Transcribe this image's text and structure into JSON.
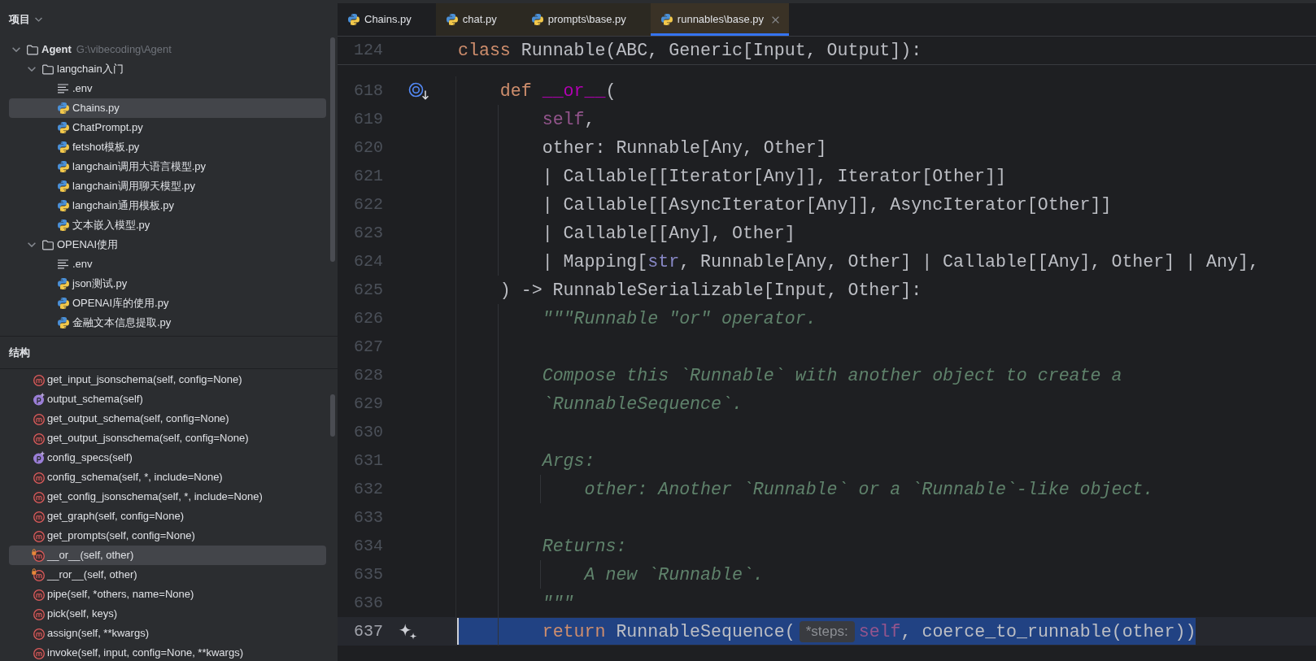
{
  "project": {
    "title": "项目",
    "tree": [
      {
        "kind": "folder",
        "label": "Agent",
        "path": "G:\\vibecoding\\Agent",
        "expanded": true,
        "selected": false,
        "children": [
          {
            "kind": "folder",
            "label": "langchain入门",
            "expanded": true,
            "selected": false,
            "children": [
              {
                "kind": "text",
                "label": ".env",
                "selected": false
              },
              {
                "kind": "python",
                "label": "Chains.py",
                "selected": true
              },
              {
                "kind": "python",
                "label": "ChatPrompt.py",
                "selected": false
              },
              {
                "kind": "python",
                "label": "fetshot模板.py",
                "selected": false
              },
              {
                "kind": "python",
                "label": "langchain调用大语言模型.py",
                "selected": false
              },
              {
                "kind": "python",
                "label": "langchain调用聊天模型.py",
                "selected": false
              },
              {
                "kind": "python",
                "label": "langchain通用模板.py",
                "selected": false
              },
              {
                "kind": "python",
                "label": "文本嵌入模型.py",
                "selected": false
              }
            ]
          },
          {
            "kind": "folder",
            "label": "OPENAI使用",
            "expanded": true,
            "selected": false,
            "children": [
              {
                "kind": "text",
                "label": ".env",
                "selected": false
              },
              {
                "kind": "python",
                "label": "json测试.py",
                "selected": false
              },
              {
                "kind": "python",
                "label": "OPENAI库的使用.py",
                "selected": false
              },
              {
                "kind": "python",
                "label": "金融文本信息提取.py",
                "selected": false
              }
            ]
          }
        ]
      }
    ]
  },
  "structure": {
    "title": "结构",
    "items": [
      {
        "kind": "method",
        "label": "get_input_jsonschema(self, config=None)",
        "locked": false,
        "selected": false
      },
      {
        "kind": "property",
        "label": "output_schema(self)",
        "locked": false,
        "selected": false
      },
      {
        "kind": "method",
        "label": "get_output_schema(self, config=None)",
        "locked": false,
        "selected": false
      },
      {
        "kind": "method",
        "label": "get_output_jsonschema(self, config=None)",
        "locked": false,
        "selected": false
      },
      {
        "kind": "property",
        "label": "config_specs(self)",
        "locked": false,
        "selected": false
      },
      {
        "kind": "method",
        "label": "config_schema(self, *, include=None)",
        "locked": false,
        "selected": false
      },
      {
        "kind": "method",
        "label": "get_config_jsonschema(self, *, include=None)",
        "locked": false,
        "selected": false
      },
      {
        "kind": "method",
        "label": "get_graph(self, config=None)",
        "locked": false,
        "selected": false
      },
      {
        "kind": "method",
        "label": "get_prompts(self, config=None)",
        "locked": false,
        "selected": false
      },
      {
        "kind": "method",
        "label": "__or__(self, other)",
        "locked": true,
        "selected": true
      },
      {
        "kind": "method",
        "label": "__ror__(self, other)",
        "locked": true,
        "selected": false
      },
      {
        "kind": "method",
        "label": "pipe(self, *others, name=None)",
        "locked": false,
        "selected": false
      },
      {
        "kind": "method",
        "label": "pick(self, keys)",
        "locked": false,
        "selected": false
      },
      {
        "kind": "method",
        "label": "assign(self, **kwargs)",
        "locked": false,
        "selected": false
      },
      {
        "kind": "method",
        "label": "invoke(self, input, config=None, **kwargs)",
        "locked": false,
        "selected": false
      }
    ]
  },
  "editor": {
    "tabs": [
      {
        "label": "Chains.py",
        "selected": false,
        "external": false
      },
      {
        "label": "chat.py",
        "selected": false,
        "external": true
      },
      {
        "label": "prompts\\base.py",
        "selected": false,
        "external": true
      },
      {
        "label": "runnables\\base.py",
        "selected": true,
        "external": true
      }
    ],
    "sticky_line": {
      "number": "124",
      "tokens": [
        {
          "kind": "keyword",
          "text": "class"
        },
        {
          "kind": "plain",
          "text": " Runnable(ABC, Generic[Input, Output]):"
        }
      ]
    },
    "lines": [
      {
        "number": "618",
        "gutter": {
          "kind": "override"
        },
        "selected": false,
        "tokens": [
          {
            "kind": "keyword",
            "text": "    def "
          },
          {
            "kind": "dunder",
            "text": "__or__"
          },
          {
            "kind": "plain",
            "text": "("
          }
        ]
      },
      {
        "number": "619",
        "selected": false,
        "tokens": [
          {
            "kind": "self",
            "text": "        self"
          },
          {
            "kind": "plain",
            "text": ","
          }
        ]
      },
      {
        "number": "620",
        "selected": false,
        "tokens": [
          {
            "kind": "plain",
            "text": "        other: Runnable[Any, Other]"
          }
        ]
      },
      {
        "number": "621",
        "selected": false,
        "tokens": [
          {
            "kind": "plain",
            "text": "        | Callable[[Iterator[Any]], Iterator[Other]]"
          }
        ]
      },
      {
        "number": "622",
        "selected": false,
        "tokens": [
          {
            "kind": "plain",
            "text": "        | Callable[[AsyncIterator[Any]], AsyncIterator[Other]]"
          }
        ]
      },
      {
        "number": "623",
        "selected": false,
        "tokens": [
          {
            "kind": "plain",
            "text": "        | Callable[[Any], Other]"
          }
        ]
      },
      {
        "number": "624",
        "selected": false,
        "tokens": [
          {
            "kind": "plain",
            "text": "        | Mapping["
          },
          {
            "kind": "builtin",
            "text": "str"
          },
          {
            "kind": "plain",
            "text": ", Runnable[Any, Other] | Callable[[Any], Other] | Any],"
          }
        ]
      },
      {
        "number": "625",
        "selected": false,
        "tokens": [
          {
            "kind": "plain",
            "text": "    ) -> RunnableSerializable[Input, Other]:"
          }
        ]
      },
      {
        "number": "626",
        "selected": false,
        "tokens": [
          {
            "kind": "doc",
            "text": "        \"\"\"Runnable \"or\" operator."
          }
        ]
      },
      {
        "number": "627",
        "selected": false
      },
      {
        "number": "628",
        "selected": false,
        "tokens": [
          {
            "kind": "doc",
            "text": "        Compose this `Runnable` with another object to create a"
          }
        ]
      },
      {
        "number": "629",
        "selected": false,
        "tokens": [
          {
            "kind": "doc",
            "text": "        `RunnableSequence`."
          }
        ]
      },
      {
        "number": "630",
        "selected": false
      },
      {
        "number": "631",
        "selected": false,
        "tokens": [
          {
            "kind": "doc",
            "text": "        Args:"
          }
        ]
      },
      {
        "number": "632",
        "selected": false,
        "tokens": [
          {
            "kind": "doc",
            "text": "            other: Another `Runnable` or a `Runnable`-like object."
          }
        ]
      },
      {
        "number": "633",
        "selected": false
      },
      {
        "number": "634",
        "selected": false,
        "tokens": [
          {
            "kind": "doc",
            "text": "        Returns:"
          }
        ]
      },
      {
        "number": "635",
        "selected": false,
        "tokens": [
          {
            "kind": "doc",
            "text": "            A new `Runnable`."
          }
        ]
      },
      {
        "number": "636",
        "selected": false,
        "tokens": [
          {
            "kind": "doc",
            "text": "        \"\"\""
          }
        ]
      },
      {
        "number": "637",
        "gutter": {
          "kind": "sparkle"
        },
        "selected": true,
        "tokens": [
          {
            "kind": "keyword",
            "text": "        return"
          },
          {
            "kind": "plain",
            "text": " RunnableSequence("
          },
          {
            "kind": "hint",
            "text": "*steps:"
          },
          {
            "kind": "self",
            "text": "self"
          },
          {
            "kind": "plain",
            "text": ", coerce_to_runnable(other))"
          }
        ]
      }
    ]
  }
}
